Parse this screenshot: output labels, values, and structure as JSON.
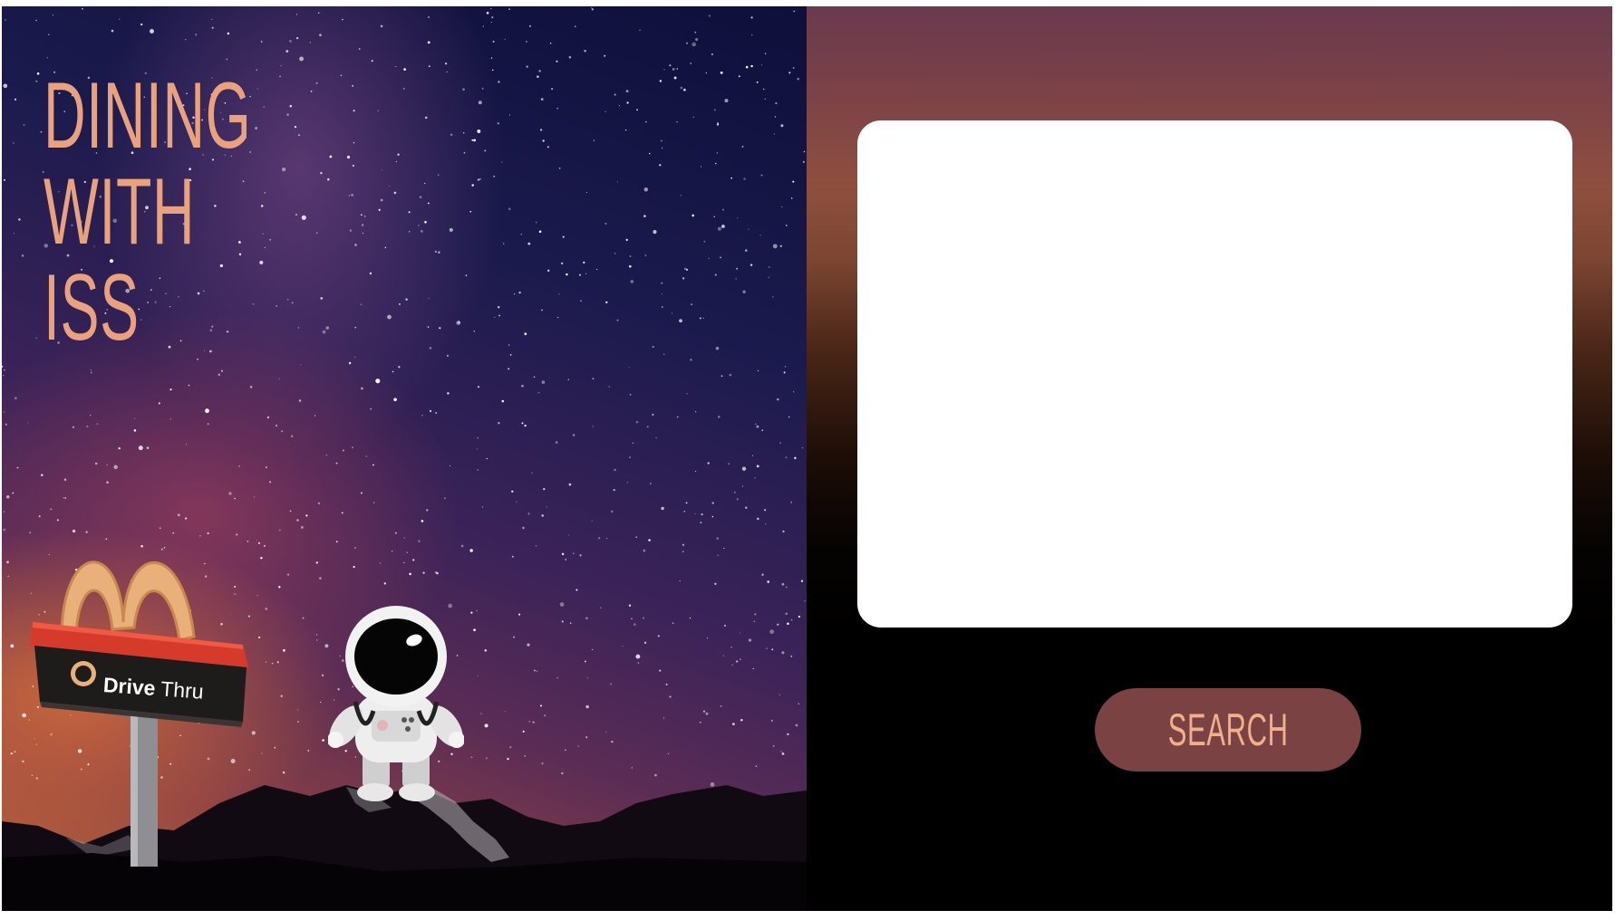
{
  "hero": {
    "title_lines": [
      "DINING",
      "WITH",
      "ISS"
    ]
  },
  "sign": {
    "brand_bold": "Drive",
    "brand_regular": "Thru"
  },
  "results": {
    "content": ""
  },
  "search": {
    "button_label": "SEARCH"
  },
  "colors": {
    "title": "#e9a27c",
    "button_bg": "#7b4244",
    "button_text": "#f0b08a",
    "right_top": "#6a3a4e",
    "right_mid": "#8f4f3f",
    "right_bottom": "#000000"
  },
  "icons": [
    "mcdonalds-drive-thru-sign-icon",
    "astronaut-icon"
  ]
}
